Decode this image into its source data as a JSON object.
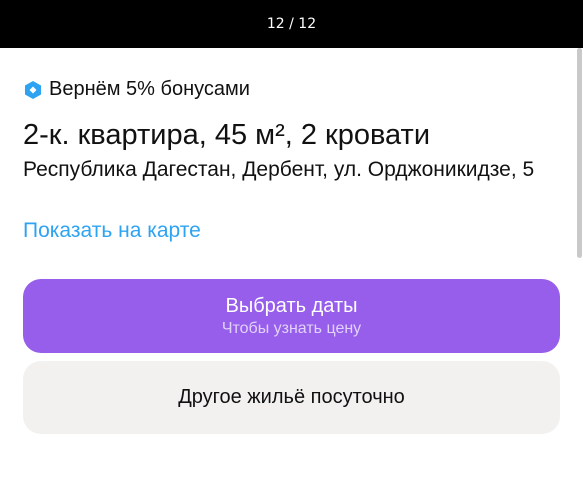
{
  "gallery": {
    "counter": "12 / 12"
  },
  "bonus": {
    "text": "Вернём 5% бонусами",
    "icon": "bonus-hexagon-icon",
    "icon_color": "#2ea3f2"
  },
  "listing": {
    "title": "2-к. квартира, 45 м², 2 кровати",
    "address": "Республика Дагестан, Дербент, ул. Орджоникидзе, 5",
    "map_link": "Показать на карте"
  },
  "actions": {
    "select_dates_label": "Выбрать даты",
    "select_dates_sub": "Чтобы узнать цену",
    "other_housing_label": "Другое жильё посуточно"
  },
  "colors": {
    "accent": "#965eeb",
    "link": "#2ea3f2",
    "secondary_button": "#f2f1f0"
  }
}
